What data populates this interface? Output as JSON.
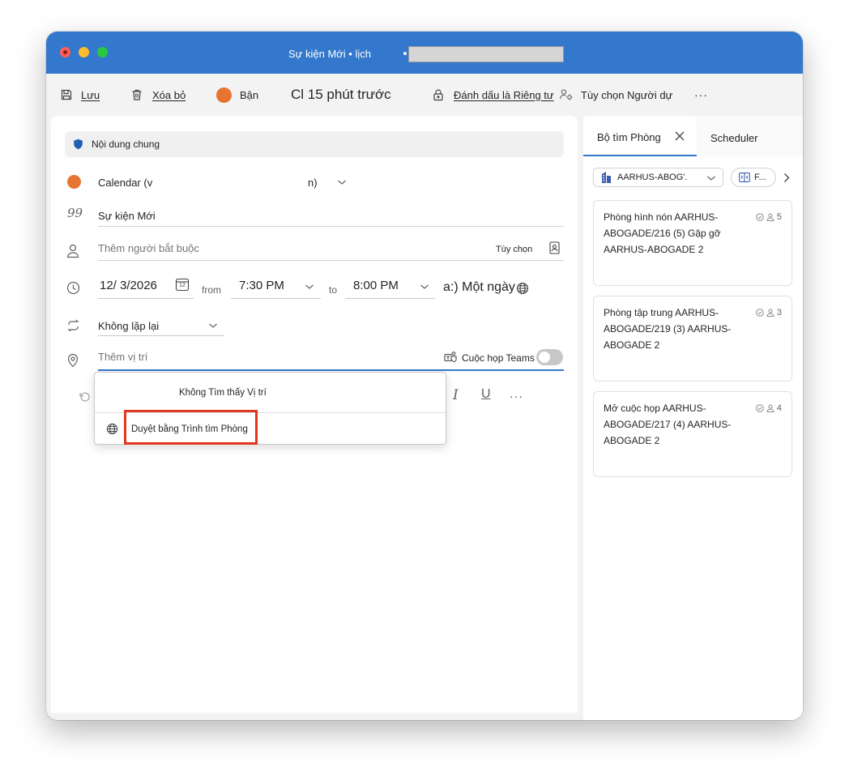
{
  "window": {
    "title": "Sự kiện Mới • lịch"
  },
  "toolbar": {
    "save_label": "Lưu",
    "delete_label": "Xóa bỏ",
    "busy_label": "Bận",
    "reminder_label": "Cl 15 phút trước",
    "private_label": "Đánh dấu là Riêng tư",
    "attendee_options_label": "Tùy chọn Người dự",
    "more_label": "···"
  },
  "form": {
    "banner_label": "Nội dung chung",
    "calendar_label": "Calendar (v",
    "calendar_suffix": "n)",
    "title_value": "Sự kiện Mới",
    "attendees_placeholder": "Thêm người bắt buộc",
    "attendees_options": "Tùy chọn",
    "date_value": "12/ 3/2026",
    "calendar_day": "12",
    "from_label": "from",
    "start_time": "7:30 PM",
    "to_label": "to",
    "end_time": "8:00 PM",
    "all_day_label": "a:) Một ngày",
    "repeat_value": "Không lặp lại",
    "location_placeholder": "Thêm vị trí",
    "teams_label": "Cuộc họp Teams",
    "more_label": "···"
  },
  "location_dropdown": {
    "no_location": "Không Tìm thấy Vị trí",
    "browse_label": "Duyệt bằng Trình tìm Phòng"
  },
  "side_panel": {
    "tabs": [
      {
        "label": "Bộ tìm Phòng"
      },
      {
        "label": "Scheduler"
      }
    ],
    "building_filter": "AARHUS-ABOG'.",
    "filter_chip": "F...",
    "rooms": [
      {
        "name": "Phòng hình nón AARHUS-ABOGADE/216 (5) Gặp gỡ AARHUS-ABOGADE 2",
        "capacity": "5"
      },
      {
        "name": "Phòng tập trung AARHUS-ABOGADE/219 (3) AARHUS-ABOGADE 2",
        "capacity": "3"
      },
      {
        "name": "Mở cuộc họp AARHUS-ABOGADE/217 (4) AARHUS-ABOGADE 2",
        "capacity": "4"
      }
    ]
  },
  "colors": {
    "titlebar": "#3378cc",
    "busy": "#e87431",
    "calendar": "#e87431",
    "highlight": "#e0371f"
  }
}
